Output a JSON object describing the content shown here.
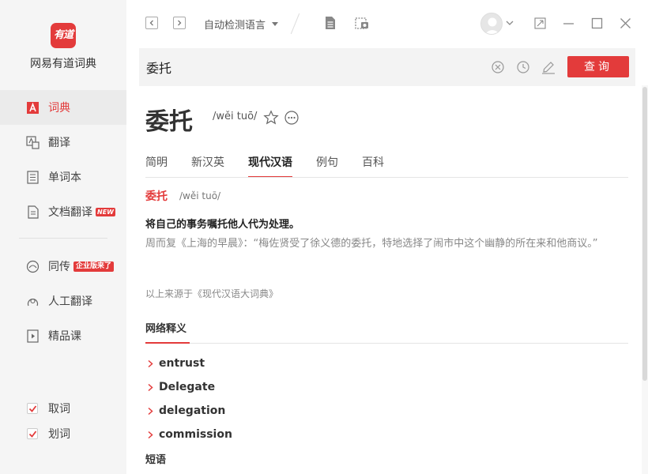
{
  "sidebar": {
    "logo_text": "有道",
    "app_name": "网易有道词典",
    "items": [
      {
        "label": "词典",
        "icon": "dictionary-icon",
        "active": true
      },
      {
        "label": "翻译",
        "icon": "translate-icon",
        "active": false
      },
      {
        "label": "单词本",
        "icon": "wordbook-icon",
        "active": false
      },
      {
        "label": "文档翻译",
        "icon": "document-icon",
        "active": false,
        "badge": "NEW"
      },
      {
        "label": "同传",
        "icon": "simultaneous-icon",
        "active": false,
        "badge": "企业版来了"
      },
      {
        "label": "人工翻译",
        "icon": "human-translate-icon",
        "active": false
      },
      {
        "label": "精品课",
        "icon": "course-icon",
        "active": false
      }
    ],
    "checks": [
      {
        "label": "取词",
        "checked": true
      },
      {
        "label": "划词",
        "checked": true
      }
    ]
  },
  "toolbar": {
    "language_select": "自动检测语言"
  },
  "search": {
    "value": "委托",
    "button_label": "查询"
  },
  "word": {
    "title": "委托",
    "phonetic": "/wěi tuō/"
  },
  "tabs": [
    "简明",
    "新汉英",
    "现代汉语",
    "例句",
    "百科"
  ],
  "active_tab": "现代汉语",
  "entry": {
    "word": "委托",
    "phonetic": "/wěi tuō/",
    "definition": "将自己的事务嘱托他人代为处理。",
    "example": "周而复《上海的早晨》：“梅佐贤受了徐义德的委托，特地选择了闹市中这个幽静的所在来和他商议。”",
    "source": "以上来源于《现代汉语大词典》"
  },
  "network": {
    "title": "网络释义",
    "items": [
      "entrust",
      "Delegate",
      "delegation",
      "commission"
    ]
  },
  "phrase_title": "短语",
  "colors": {
    "accent": "#e33b3b",
    "sidebar_bg": "#f5f5f5"
  }
}
